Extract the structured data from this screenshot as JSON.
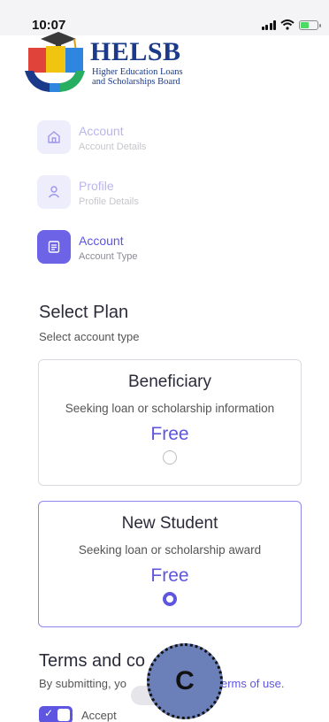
{
  "status_bar": {
    "time": "10:07"
  },
  "logo": {
    "title": "HELSB",
    "subtitle_line1": "Higher Education Loans",
    "subtitle_line2": "and Scholarships Board",
    "brand_color": "#1b3a8a"
  },
  "steps": [
    {
      "title": "Account",
      "subtitle": "Account Details",
      "icon": "home-icon",
      "active": false
    },
    {
      "title": "Profile",
      "subtitle": "Profile Details",
      "icon": "user-icon",
      "active": false
    },
    {
      "title": "Account",
      "subtitle": "Account Type",
      "icon": "document-icon",
      "active": true
    }
  ],
  "select_plan": {
    "title": "Select Plan",
    "subtitle": "Select account type"
  },
  "plans": [
    {
      "name": "Beneficiary",
      "description": "Seeking loan or scholarship information",
      "price": "Free",
      "selected": false
    },
    {
      "name": "New Student",
      "description": "Seeking loan or scholarship award",
      "price": "Free",
      "selected": true
    }
  ],
  "terms": {
    "title_start": "Terms and co",
    "title_end": "s",
    "text": "By submitting, yo",
    "link": "erms of use.",
    "accept_label": "Accept",
    "accepted": true
  },
  "overlay": {
    "label": "C",
    "color": "#6b7fb8"
  },
  "colors": {
    "accent": "#5e56e0",
    "accent_light": "#eeedfb"
  }
}
